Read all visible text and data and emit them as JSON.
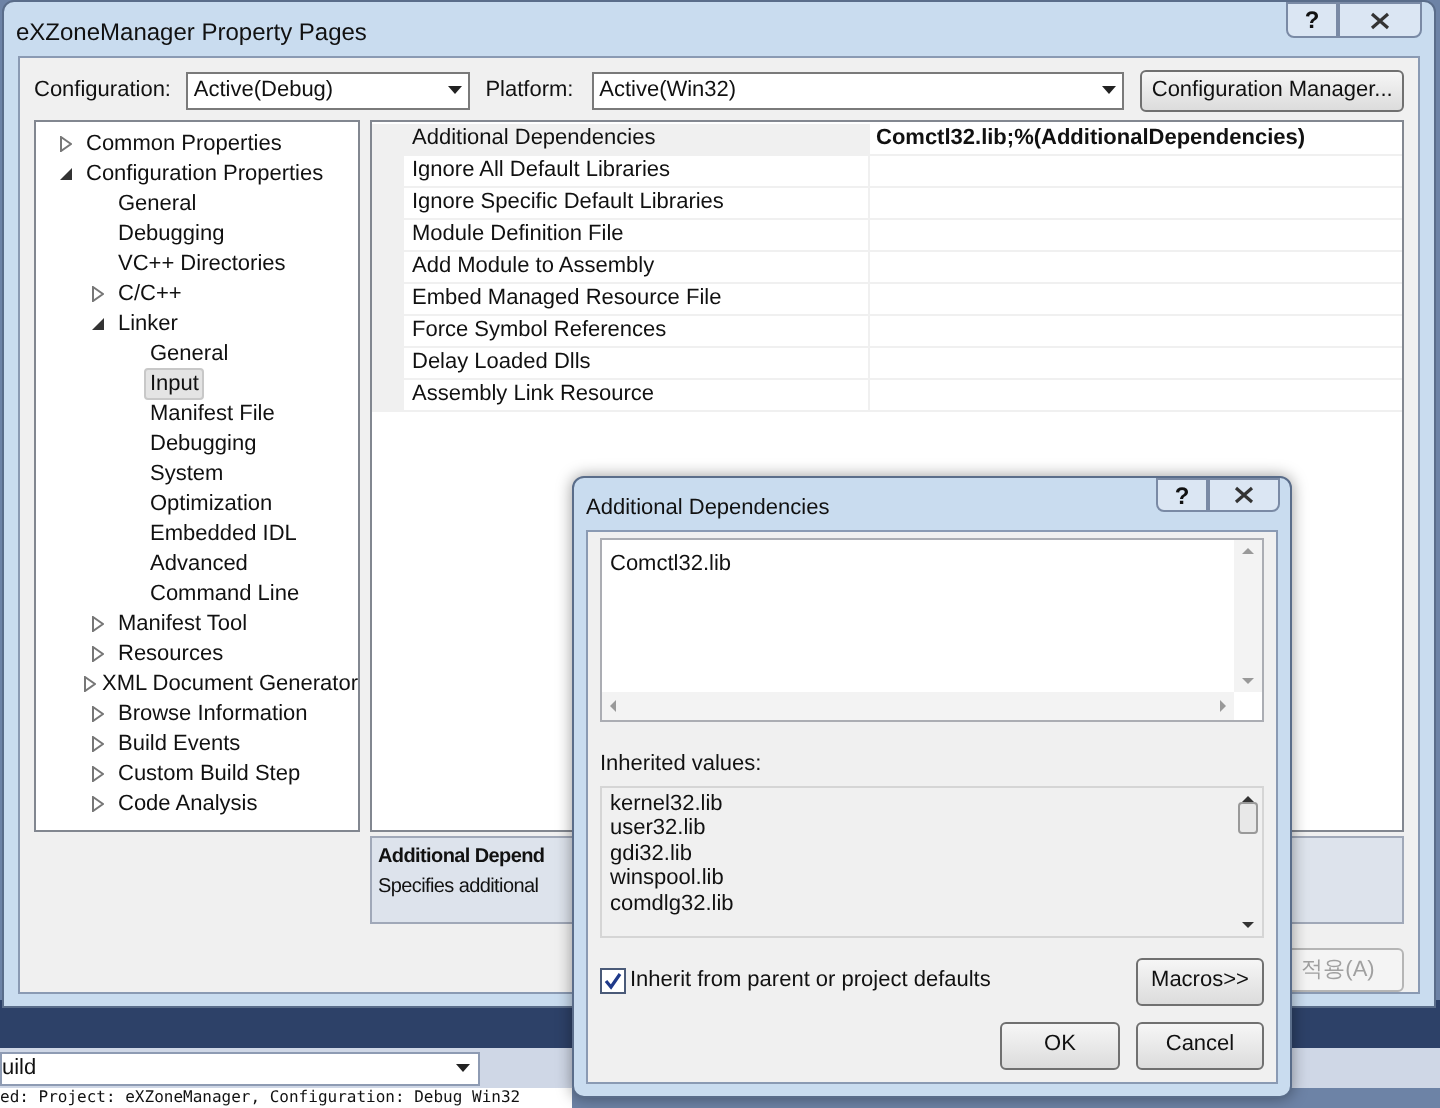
{
  "window": {
    "title": "eXZoneManager Property Pages",
    "help": "?"
  },
  "configuration": {
    "label": "Configuration:",
    "value": "Active(Debug)"
  },
  "platform": {
    "label": "Platform:",
    "value": "Active(Win32)"
  },
  "configuration_manager_button": "Configuration Manager...",
  "tree": [
    {
      "label": "Common Properties",
      "expanded": false,
      "selected": false
    },
    {
      "label": "Configuration Properties",
      "expanded": true,
      "selected": false,
      "children": [
        {
          "label": "General",
          "selected": false
        },
        {
          "label": "Debugging",
          "selected": false
        },
        {
          "label": "VC++ Directories",
          "selected": false
        },
        {
          "label": "C/C++",
          "expanded": false,
          "selected": false
        },
        {
          "label": "Linker",
          "expanded": true,
          "selected": false,
          "children": [
            {
              "label": "General",
              "selected": false
            },
            {
              "label": "Input",
              "selected": true
            },
            {
              "label": "Manifest File",
              "selected": false
            },
            {
              "label": "Debugging",
              "selected": false
            },
            {
              "label": "System",
              "selected": false
            },
            {
              "label": "Optimization",
              "selected": false
            },
            {
              "label": "Embedded IDL",
              "selected": false
            },
            {
              "label": "Advanced",
              "selected": false
            },
            {
              "label": "Command Line",
              "selected": false
            }
          ]
        },
        {
          "label": "Manifest Tool",
          "expanded": false,
          "selected": false
        },
        {
          "label": "Resources",
          "expanded": false,
          "selected": false
        },
        {
          "label": "XML Document Generator",
          "expanded": false,
          "selected": false
        },
        {
          "label": "Browse Information",
          "expanded": false,
          "selected": false
        },
        {
          "label": "Build Events",
          "expanded": false,
          "selected": false
        },
        {
          "label": "Custom Build Step",
          "expanded": false,
          "selected": false
        },
        {
          "label": "Code Analysis",
          "expanded": false,
          "selected": false
        }
      ]
    }
  ],
  "properties": [
    {
      "name": "Additional Dependencies",
      "value": "Comctl32.lib;%(AdditionalDependencies)",
      "selected": true
    },
    {
      "name": "Ignore All Default Libraries",
      "selected": false
    },
    {
      "name": "Ignore Specific Default Libraries",
      "selected": false
    },
    {
      "name": "Module Definition File",
      "selected": false
    },
    {
      "name": "Add Module to Assembly",
      "selected": false
    },
    {
      "name": "Embed Managed Resource File",
      "selected": false
    },
    {
      "name": "Force Symbol References",
      "selected": false
    },
    {
      "name": "Delay Loaded Dlls",
      "selected": false
    },
    {
      "name": "Assembly Link Resource",
      "selected": false
    }
  ],
  "description": {
    "title": "Additional Depend",
    "text": "Specifies additional"
  },
  "apply_button": {
    "label": "적용(A)",
    "disabled": true
  },
  "background": {
    "toolbar_combo": "uild",
    "status_text": "ed: Project: eXZoneManager, Configuration: Debug Win32"
  },
  "dialog": {
    "title": "Additional Dependencies",
    "help": "?",
    "value": "Comctl32.lib",
    "inherited_label": "Inherited values:",
    "inherited_values": [
      "kernel32.lib",
      "user32.lib",
      "gdi32.lib",
      "winspool.lib",
      "comdlg32.lib"
    ],
    "inherit": {
      "label": "Inherit from parent or project defaults",
      "checked": true
    },
    "macros_button": "Macros>>",
    "ok_button": "OK",
    "cancel_button": "Cancel"
  }
}
